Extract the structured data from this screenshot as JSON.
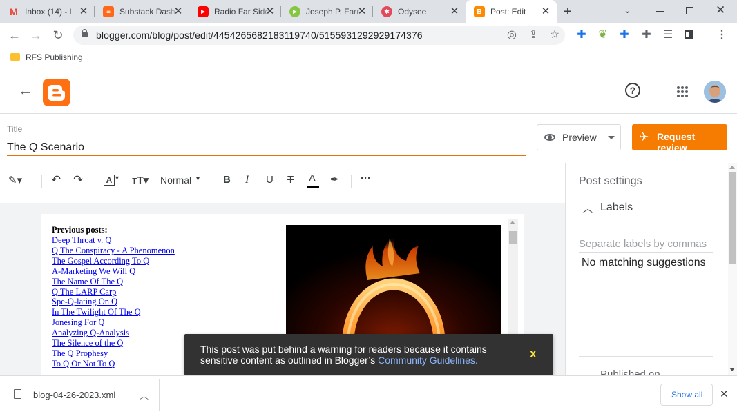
{
  "browser": {
    "tabs": [
      {
        "label": "Inbox (14) - l",
        "icon": "gmail-icon",
        "color": "#ea4335"
      },
      {
        "label": "Substack Dash",
        "icon": "substack-icon",
        "color": "#ff6719"
      },
      {
        "label": "Radio Far Side",
        "icon": "youtube-icon",
        "color": "#ff0000"
      },
      {
        "label": "Joseph P. Farr",
        "icon": "rumble-icon",
        "color": "#85c742"
      },
      {
        "label": "Odysee",
        "icon": "odysee-icon",
        "color": "#e2495b"
      },
      {
        "label": "Post: Edit",
        "icon": "blogger-icon",
        "color": "#ff8a00"
      }
    ],
    "new_tab": "+",
    "url": "blogger.com/blog/post/edit/4454265682183119740/5155931292929174376",
    "bookmark": "RFS Publishing"
  },
  "header": {
    "back_label": "←",
    "help_label": "?"
  },
  "post": {
    "title_label": "Title",
    "title": "The Q Scenario"
  },
  "actions": {
    "preview": "Preview",
    "request_review": "Request review"
  },
  "format_toolbar": {
    "paragraph_style": "Normal"
  },
  "content": {
    "previous_heading": "Previous posts:",
    "links": [
      "Deep Throat v. Q",
      "Q The Conspiracy - A Phenomenon",
      "The Gospel According To Q",
      "A-Marketing We Will Q",
      "The Name Of The Q",
      "Q The LARP Carp",
      "Spe-Q-lating On Q",
      "In The Twilight Of The Q",
      "Jonesing For Q",
      "Analyzing Q-Analysis",
      "The Silence of the Q",
      "The Q Prophesy",
      "To Q Or Not To Q"
    ]
  },
  "settings": {
    "title": "Post settings",
    "labels_section": "Labels",
    "labels_placeholder": "Separate labels by commas",
    "no_suggestions": "No matching suggestions",
    "published_on": "Published on"
  },
  "toast": {
    "message": "This post was put behind a warning for readers because it contains sensitive content as outlined in Blogger’s",
    "link": "Community Guidelines.",
    "close": "X"
  },
  "downloads": {
    "filename": "blog-04-26-2023.xml",
    "show_all": "Show all"
  },
  "colors": {
    "accent_orange": "#f57c00",
    "blogger_orange": "#ff7012",
    "link_blue": "#0000ee",
    "toast_link": "#8ab4f8"
  }
}
